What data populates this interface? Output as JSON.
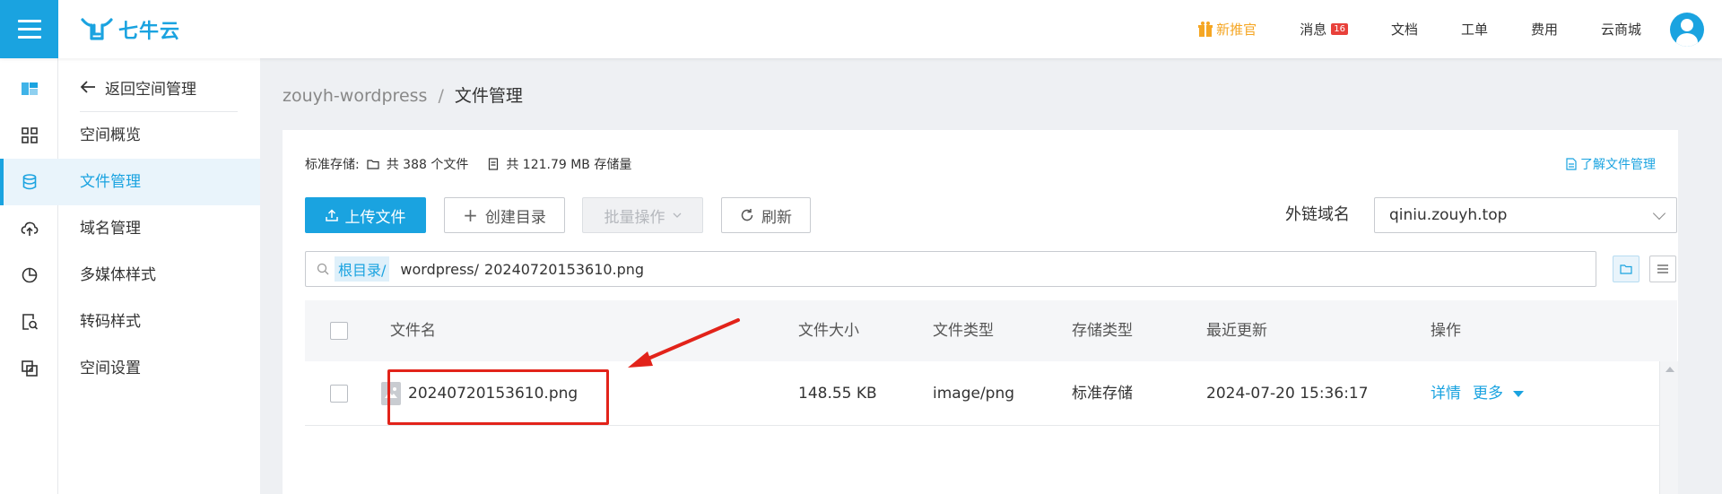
{
  "topbar": {
    "brand": "七牛云",
    "nav": [
      {
        "label": "新推官",
        "icon": "gift-icon"
      },
      {
        "label": "消息",
        "badge": "16"
      },
      {
        "label": "文档"
      },
      {
        "label": "工单"
      },
      {
        "label": "费用"
      },
      {
        "label": "云商城"
      }
    ]
  },
  "sidebar": {
    "back_label": "返回空间管理",
    "items": [
      {
        "label": "空间概览"
      },
      {
        "label": "文件管理",
        "active": true
      },
      {
        "label": "域名管理"
      },
      {
        "label": "多媒体样式"
      },
      {
        "label": "转码样式"
      },
      {
        "label": "空间设置"
      }
    ]
  },
  "breadcrumb": {
    "bucket": "zouyh-wordpress",
    "separator": "/",
    "current": "文件管理"
  },
  "stats": {
    "storage_type": "标准存储:",
    "files": "共 388 个文件",
    "size": "共 121.79 MB 存储量",
    "learn_more": "了解文件管理"
  },
  "toolbar": {
    "upload": "上传文件",
    "create_dir": "创建目录",
    "batch": "批量操作",
    "refresh": "刷新",
    "domain_label": "外链域名",
    "domain_value": "qiniu.zouyh.top"
  },
  "path": {
    "root": "根目录/",
    "segments": [
      "wordpress/",
      "20240720153610.png"
    ]
  },
  "table": {
    "columns": [
      "文件名",
      "文件大小",
      "文件类型",
      "存储类型",
      "最近更新",
      "操作"
    ],
    "rows": [
      {
        "name": "20240720153610.png",
        "size": "148.55 KB",
        "type": "image/png",
        "storage": "标准存储",
        "updated": "2024-07-20 15:36:17",
        "actions": [
          "详情",
          "更多"
        ]
      }
    ]
  },
  "colors": {
    "accent": "#1aa3e0",
    "promo": "#f5a623",
    "annotation": "#e2231a"
  }
}
